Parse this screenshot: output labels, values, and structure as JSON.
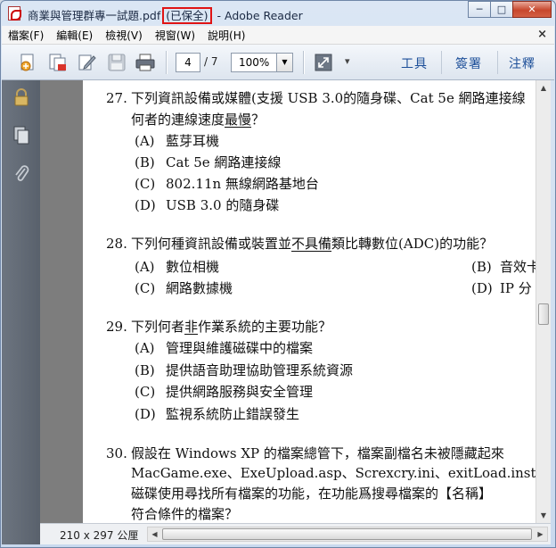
{
  "titlebar": {
    "file_name": "商業與管理群專一試題.pdf",
    "saved_tag": "(已保全)",
    "separator": " - ",
    "app_name": "Adobe Reader",
    "minimize": "─",
    "maximize": "□",
    "close": "✕"
  },
  "menu": {
    "items": [
      "檔案(F)",
      "編輯(E)",
      "檢視(V)",
      "視窗(W)",
      "說明(H)"
    ],
    "close": "×"
  },
  "toolbar": {
    "page_current": "4",
    "page_total": "/ 7",
    "zoom": "100%",
    "zoom_arrow": "▼",
    "more": "▾",
    "tools": "工具",
    "sign": "簽署",
    "comment": "注釋"
  },
  "document": {
    "q27": {
      "num": "27.",
      "line1": "下列資訊設備或媒體(支援 USB 3.0的隨身碟、Cat 5e 網路連接線",
      "line2_pre": "何者的連線速度",
      "line2_emph": "最慢",
      "line2_post": "？",
      "options": [
        {
          "label": "(A)",
          "text": "藍芽耳機"
        },
        {
          "label": "(B)",
          "text": "Cat 5e 網路連接線"
        },
        {
          "label": "(C)",
          "text": "802.11n 無線網路基地台"
        },
        {
          "label": "(D)",
          "text": "USB 3.0 的隨身碟"
        }
      ]
    },
    "q28": {
      "num": "28.",
      "pre": "下列何種資訊設備或裝置並",
      "emph": "不具備",
      "post": "類比轉數位(ADC)的功能？",
      "options_left": [
        {
          "label": "(A)",
          "text": "數位相機"
        },
        {
          "label": "(C)",
          "text": "網路數據機"
        }
      ],
      "options_right": [
        {
          "label": "(B)",
          "text": "音效卡"
        },
        {
          "label": "(D)",
          "text": "IP 分"
        }
      ]
    },
    "q29": {
      "num": "29.",
      "pre": "下列何者",
      "emph": "非",
      "post": "作業系統的主要功能？",
      "options": [
        {
          "label": "(A)",
          "text": "管理與維護磁碟中的檔案"
        },
        {
          "label": "(B)",
          "text": "提供語音助理協助管理系統資源"
        },
        {
          "label": "(C)",
          "text": "提供網路服務與安全管理"
        },
        {
          "label": "(D)",
          "text": "監視系統防止錯誤發生"
        }
      ]
    },
    "q30": {
      "num": "30.",
      "line1": "假設在 Windows XP 的檔案總管下，檔案副檔名未被隱藏起來",
      "line2": "MacGame.exe、ExeUpload.asp、Screxcry.ini、exitLoad.install.exe",
      "line3": "磁碟使用尋找所有檔案的功能，在功能爲搜尋檔案的【名稱】",
      "line4": "符合條件的檔案？"
    }
  },
  "status": {
    "page_size": "210 x 297 公厘"
  }
}
